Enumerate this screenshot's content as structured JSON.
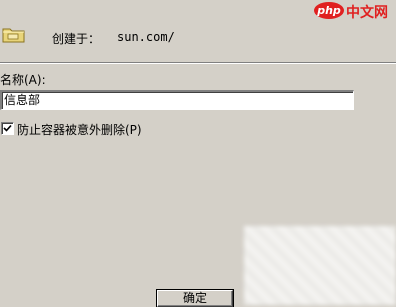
{
  "dialog": {
    "icon": "folder-ou-icon",
    "created_in_label": "创建于：",
    "created_in_value": "sun.com/",
    "name_label": "名称(A):",
    "name_value": "信息部",
    "protect_label": "防止容器被意外删除(P)",
    "protect_checked": true,
    "ok_label": "确定"
  },
  "watermark": {
    "badge": "php",
    "text": "中文网"
  },
  "colors": {
    "dialog_bg": "#d4d0c8",
    "watermark_red": "#e02020"
  }
}
